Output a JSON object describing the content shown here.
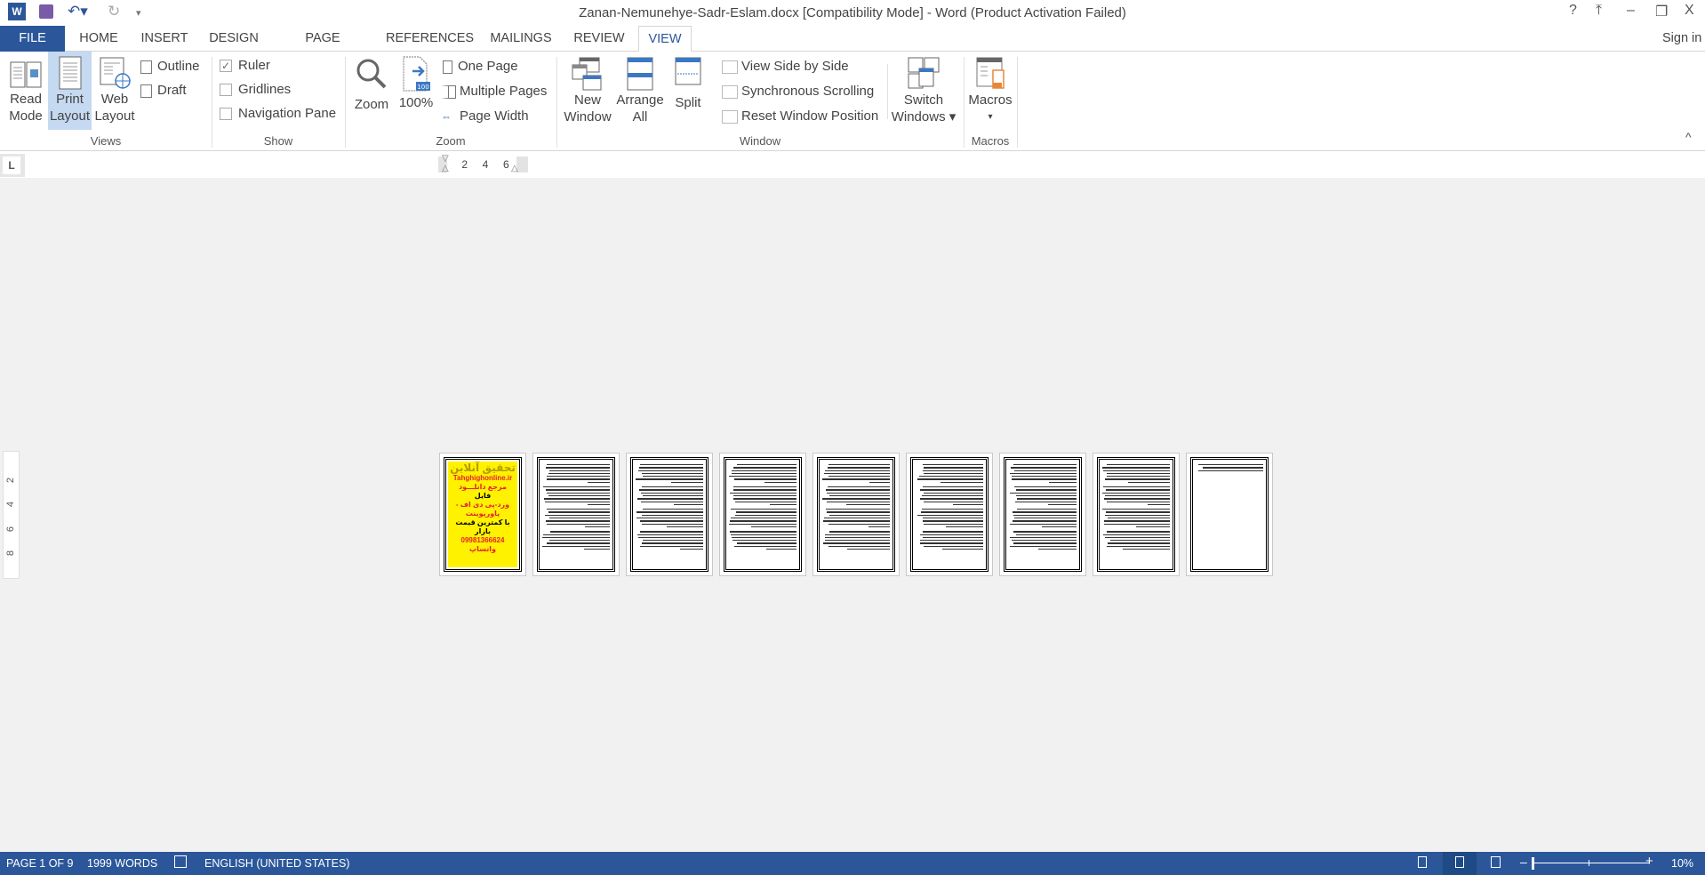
{
  "window": {
    "title": "Zanan-Nemunehye-Sadr-Eslam.docx [Compatibility Mode] - Word (Product Activation Failed)",
    "help": "?",
    "ribbon_display": "⤒",
    "minimize": "–",
    "restore": "❐",
    "close": "X",
    "sign_in": "Sign in"
  },
  "quick_access": {
    "app_icon": "word-icon",
    "save": "save-icon",
    "undo": "undo-icon",
    "redo": "redo-icon",
    "customize": "▾"
  },
  "tabs": [
    {
      "label": "FILE"
    },
    {
      "label": "HOME"
    },
    {
      "label": "INSERT"
    },
    {
      "label": "DESIGN"
    },
    {
      "label": "PAGE LAYOUT"
    },
    {
      "label": "REFERENCES"
    },
    {
      "label": "MAILINGS"
    },
    {
      "label": "REVIEW"
    },
    {
      "label": "VIEW",
      "active": true
    }
  ],
  "ribbon": {
    "views": {
      "label": "Views",
      "read_mode": [
        "Read",
        "Mode"
      ],
      "print_layout": [
        "Print",
        "Layout"
      ],
      "web_layout": [
        "Web",
        "Layout"
      ],
      "outline": "Outline",
      "draft": "Draft",
      "selected": "Print Layout"
    },
    "show": {
      "label": "Show",
      "ruler": "Ruler",
      "ruler_checked": true,
      "gridlines": "Gridlines",
      "gridlines_checked": false,
      "nav_pane": "Navigation Pane",
      "nav_pane_checked": false
    },
    "zoom": {
      "label": "Zoom",
      "zoom": "Zoom",
      "hundred": "100%",
      "hundred_badge": "100",
      "one_page": "One Page",
      "multiple_pages": "Multiple Pages",
      "page_width": "Page Width"
    },
    "window": {
      "label": "Window",
      "new_window": [
        "New",
        "Window"
      ],
      "arrange_all": [
        "Arrange",
        "All"
      ],
      "split": "Split",
      "side_by_side": "View Side by Side",
      "sync_scroll": "Synchronous Scrolling",
      "reset_pos": "Reset Window Position",
      "switch_windows": [
        "Switch",
        "Windows ▾"
      ]
    },
    "macros": {
      "label": "Macros",
      "macros": "Macros",
      "arrow": "▾"
    },
    "collapse": "^"
  },
  "ruler": {
    "tab_selector": "L",
    "h_ticks": [
      "2",
      "4",
      "6"
    ],
    "v_ticks": [
      "2",
      "4",
      "6",
      "8"
    ]
  },
  "document": {
    "page_count": 9,
    "ad": {
      "title": "تحقیق آنلاین",
      "site": "Tahghighonline.ir",
      "l1": "مرجع دانلـــود",
      "l2": "فایل",
      "l3": "ورد-پی دی اف - پاورپوینت",
      "l4": "با کمترین قیمت بازار",
      "l5": "09981366624 واتساپ"
    }
  },
  "status": {
    "page": "PAGE 1 OF 9",
    "words": "1999 WORDS",
    "proofing_icon": "proofing-icon",
    "language": "ENGLISH (UNITED STATES)",
    "zoom_minus": "–",
    "zoom_plus": "+",
    "zoom_level": "10%",
    "zoom_percent": 10
  },
  "colors": {
    "accent": "#2b579a",
    "ad_bg": "#fff200",
    "ad_red": "#e8202a"
  }
}
